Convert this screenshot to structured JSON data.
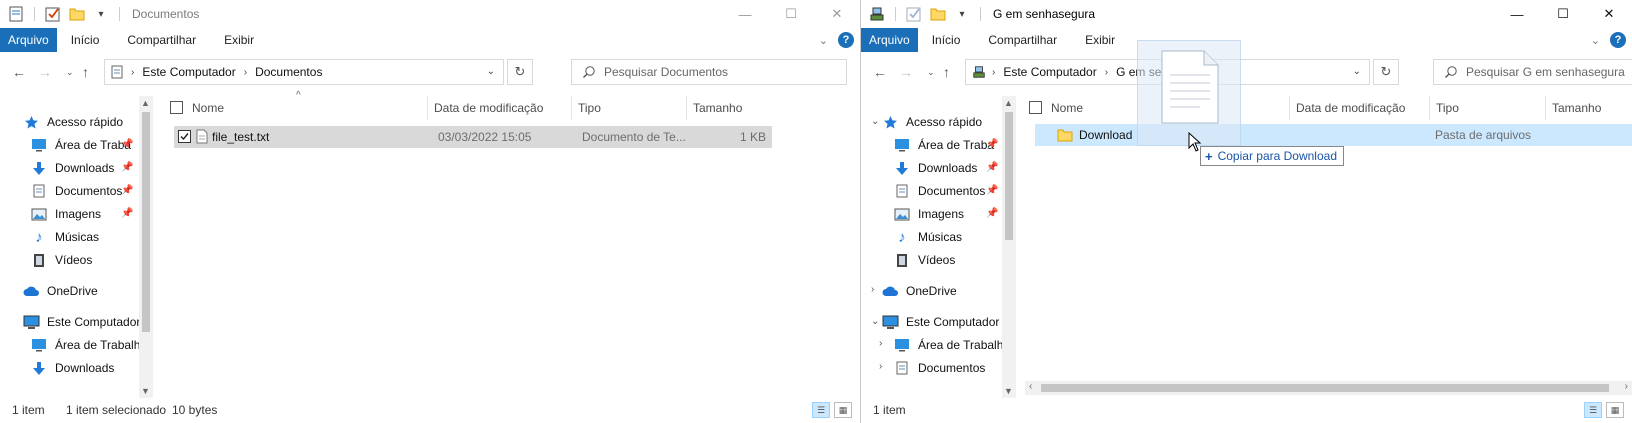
{
  "left": {
    "title": "Documentos",
    "ribbon_tabs": [
      "Arquivo",
      "Início",
      "Compartilhar",
      "Exibir"
    ],
    "breadcrumb": [
      "Este Computador",
      "Documentos"
    ],
    "search_placeholder": "Pesquisar Documentos",
    "nav": {
      "quick_access": "Acesso rápido",
      "items": [
        "Área de Traba",
        "Downloads",
        "Documentos",
        "Imagens",
        "Músicas",
        "Vídeos"
      ],
      "onedrive": "OneDrive",
      "this_pc": "Este Computador",
      "pc_items": [
        "Área de Trabalho",
        "Downloads"
      ]
    },
    "columns": [
      "Nome",
      "Data de modificação",
      "Tipo",
      "Tamanho"
    ],
    "files": [
      {
        "name": "file_test.txt",
        "date": "03/03/2022 15:05",
        "type": "Documento de Te...",
        "size": "1 KB"
      }
    ],
    "status": {
      "count": "1 item",
      "selected": "1 item selecionado",
      "size": "10 bytes"
    }
  },
  "right": {
    "title": "G em senhasegura",
    "ribbon_tabs": [
      "Arquivo",
      "Início",
      "Compartilhar",
      "Exibir"
    ],
    "breadcrumb": [
      "Este Computador",
      "G em senhasegura"
    ],
    "search_placeholder": "Pesquisar G em senhasegura",
    "nav": {
      "quick_access": "Acesso rápido",
      "items": [
        "Área de Traba",
        "Downloads",
        "Documentos",
        "Imagens",
        "Músicas",
        "Vídeos"
      ],
      "onedrive": "OneDrive",
      "this_pc": "Este Computador",
      "pc_items": [
        "Área de Trabalho",
        "Documentos"
      ]
    },
    "columns": [
      "Nome",
      "Data de modificação",
      "Tipo",
      "Tamanho"
    ],
    "files": [
      {
        "name": "Download",
        "date": "",
        "type": "Pasta de arquivos",
        "size": ""
      }
    ],
    "status": {
      "count": "1 item"
    }
  },
  "drag": {
    "tooltip": "Copiar para Download"
  },
  "colors": {
    "accent": "#1a6fb8",
    "selected_row": "#cce8ff",
    "selected_gray": "#d9d9d9"
  }
}
